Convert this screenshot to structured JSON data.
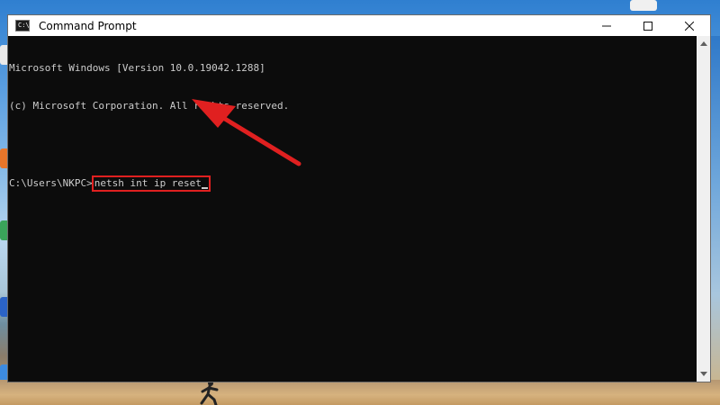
{
  "window": {
    "title": "Command Prompt",
    "icon": "cmd-icon",
    "icon_glyph": "C:\\",
    "controls": [
      "minimize-icon",
      "maximize-icon",
      "close-icon"
    ]
  },
  "console": {
    "lines": [
      "Microsoft Windows [Version 10.0.19042.1288]",
      "(c) Microsoft Corporation. All rights reserved.",
      ""
    ],
    "prompt": "C:\\Users\\NKPC>",
    "command": "netsh int ip reset"
  },
  "annotation": {
    "highlight_color": "#e02020",
    "arrow_color": "#e02020"
  }
}
